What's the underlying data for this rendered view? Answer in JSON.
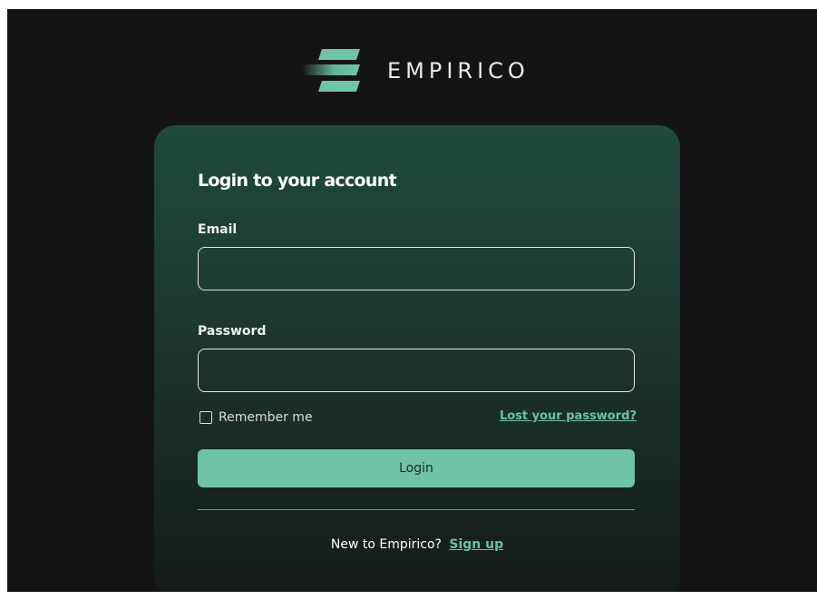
{
  "brand": {
    "name": "EMPIRICO",
    "logo_icon": "empirico-stripes-icon"
  },
  "login_form": {
    "title": "Login to your account",
    "email": {
      "label": "Email",
      "value": "",
      "placeholder": ""
    },
    "password": {
      "label": "Password",
      "value": "",
      "placeholder": ""
    },
    "remember_me": {
      "label": "Remember me",
      "checked": false
    },
    "lost_password_label": "Lost your password?",
    "submit_label": "Login",
    "signup_prompt": "New to Empirico?",
    "signup_label": "Sign up"
  },
  "colors": {
    "accent": "#6fc4a6",
    "link": "#6cc3a3",
    "background": "#141417",
    "card_top": "#1f4a3d",
    "card_bottom": "#141a18"
  }
}
